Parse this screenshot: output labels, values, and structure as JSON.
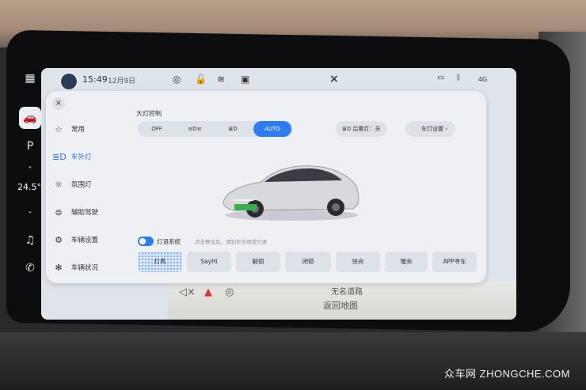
{
  "status_bar": {
    "time": "15:49",
    "date": "12月9日",
    "signal": "4G"
  },
  "rail": {
    "temperature": "24.5°"
  },
  "panel": {
    "close": "×",
    "sidebar": [
      {
        "label": "常用",
        "icon": "star-icon"
      },
      {
        "label": "车外灯",
        "icon": "headlight-icon"
      },
      {
        "label": "氛围灯",
        "icon": "sun-icon"
      },
      {
        "label": "辅助驾驶",
        "icon": "steering-icon"
      },
      {
        "label": "车辆设置",
        "icon": "gear-icon"
      },
      {
        "label": "车辆状况",
        "icon": "wheel-icon"
      }
    ],
    "headlight_title": "大灯控制",
    "headlight_modes": [
      "OFF",
      "",
      "",
      "AUTO"
    ],
    "active_mode": "AUTO",
    "fog_light": "后雾灯：关",
    "light_settings": "车灯设置",
    "light_language_label": "灯语系统",
    "light_language_hint": "点击预览后，请到车外观赏灯语",
    "light_buttons": [
      "灯秀",
      "SayHi",
      "解锁",
      "闭锁",
      "快充",
      "慢充",
      "APP寻车"
    ]
  },
  "map": {
    "road": "无名道路",
    "return": "返回地图"
  },
  "watermark": "众车网 ZHONGCHE.COM",
  "colors": {
    "accent": "#2f7bf0",
    "panel": "#eef0f4"
  }
}
